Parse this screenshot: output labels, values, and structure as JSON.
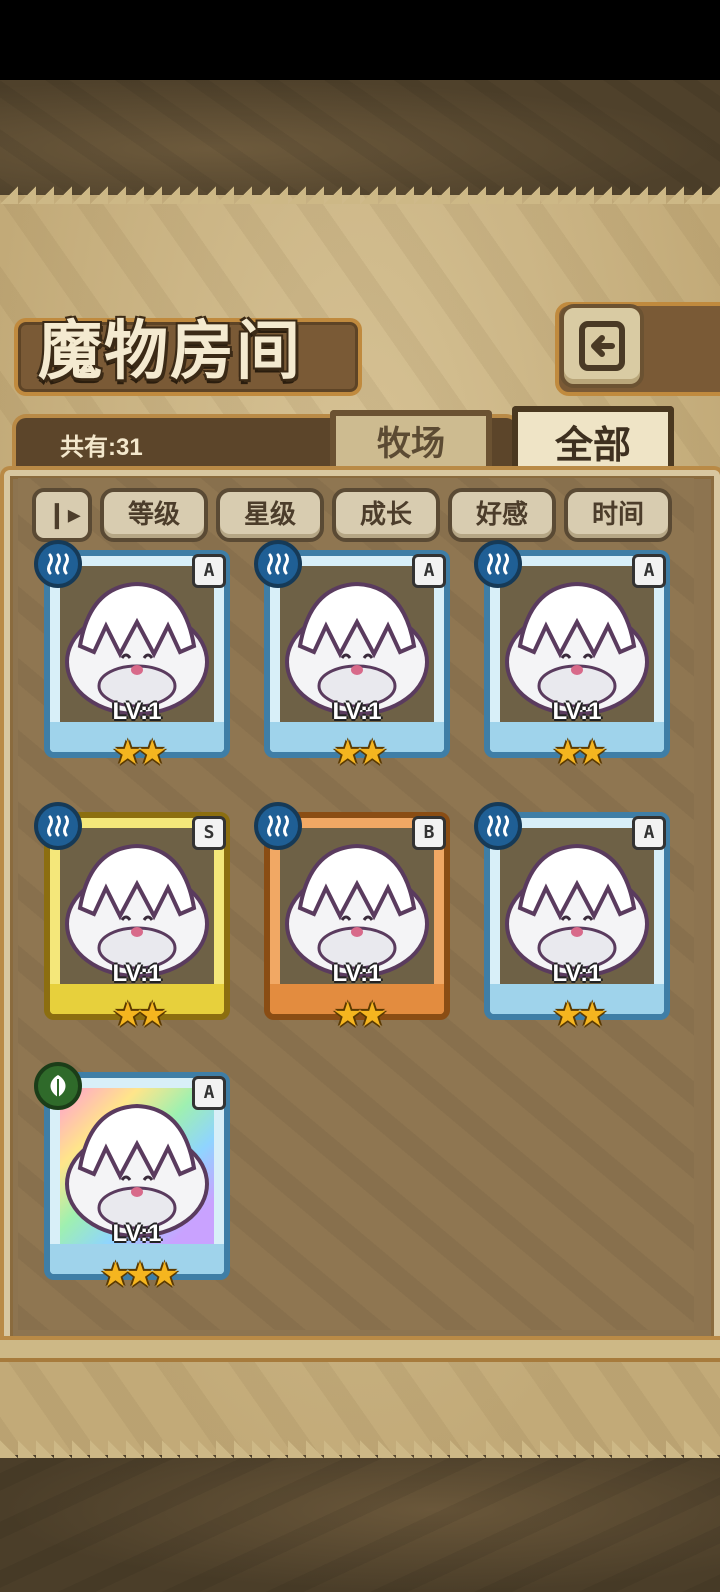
{
  "header": {
    "title": "魔物房间",
    "back_icon": "back-arrow-icon"
  },
  "summary": {
    "count_label": "共有:31"
  },
  "tabs": [
    {
      "label": "牧场",
      "active": false
    },
    {
      "label": "全部",
      "active": true
    }
  ],
  "sort": {
    "order_toggle_icon": "sort-order-icon",
    "buttons": [
      "等级",
      "星级",
      "成长",
      "好感",
      "时间"
    ]
  },
  "monsters": [
    {
      "rank": "A",
      "level": "LV:1",
      "stars": "★★",
      "element": "water-icon",
      "frame": "blue"
    },
    {
      "rank": "A",
      "level": "LV:1",
      "stars": "★★",
      "element": "water-icon",
      "frame": "blue"
    },
    {
      "rank": "A",
      "level": "LV:1",
      "stars": "★★",
      "element": "water-icon",
      "frame": "blue"
    },
    {
      "rank": "S",
      "level": "LV:1",
      "stars": "★★",
      "element": "water-icon",
      "frame": "yellow"
    },
    {
      "rank": "B",
      "level": "LV:1",
      "stars": "★★",
      "element": "water-icon",
      "frame": "orange"
    },
    {
      "rank": "A",
      "level": "LV:1",
      "stars": "★★",
      "element": "water-icon",
      "frame": "blue"
    },
    {
      "rank": "A",
      "level": "LV:1",
      "stars": "★★★",
      "element": "leaf-icon",
      "frame": "rainbow"
    }
  ]
}
